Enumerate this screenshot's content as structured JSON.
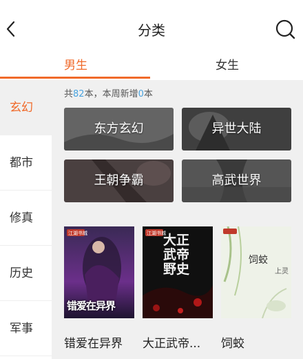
{
  "header": {
    "title": "分类",
    "back_icon": "chevron-left-icon",
    "search_icon": "search-icon"
  },
  "tabs": [
    {
      "label": "男生",
      "active": true
    },
    {
      "label": "女生",
      "active": false
    }
  ],
  "sidebar": {
    "items": [
      {
        "label": "玄幻",
        "active": true
      },
      {
        "label": "都市",
        "active": false
      },
      {
        "label": "修真",
        "active": false
      },
      {
        "label": "历史",
        "active": false
      },
      {
        "label": "军事",
        "active": false
      }
    ]
  },
  "summary": {
    "prefix": "共",
    "total": "82",
    "middle": "本，本周新增",
    "new": "0",
    "suffix": "本"
  },
  "subcategories": [
    {
      "label": "东方玄幻"
    },
    {
      "label": "异世大陆"
    },
    {
      "label": "王朝争霸"
    },
    {
      "label": "高武世界"
    }
  ],
  "books": [
    {
      "title": "错爱在异界",
      "cover_text": "错爱在异界",
      "badge": "江湖书城"
    },
    {
      "title": "大正武帝...",
      "cover_text": "大正武帝野史",
      "badge": "江湖书城"
    },
    {
      "title": "饲蛟",
      "cover_text": "饲蛟",
      "author": "上灵"
    }
  ],
  "colors": {
    "accent": "#f06a2a",
    "count_number": "#4aa3df",
    "panel_bg": "#f0f0f0"
  }
}
